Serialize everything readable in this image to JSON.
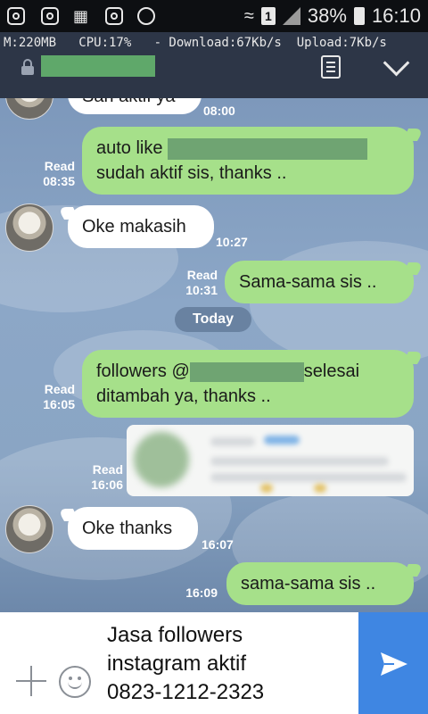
{
  "status_bar": {
    "battery": "38%",
    "time": "16:10",
    "sim_badge": "1"
  },
  "monitor": "M:220MB   CPU:17%   - Download:67Kb/s  Upload:7Kb/s",
  "messages": [
    {
      "dir": "in",
      "text": "Sari aktif ya",
      "time": "08:00"
    },
    {
      "dir": "out",
      "line1": "auto like",
      "line2": "sudah aktif sis, thanks ..",
      "read": "Read",
      "time": "08:35"
    },
    {
      "dir": "in",
      "text": "Oke makasih",
      "time": "10:27"
    },
    {
      "dir": "out",
      "text": "Sama-sama sis ..",
      "read": "Read",
      "time": "10:31"
    },
    {
      "dir": "out",
      "line1a": "followers @",
      "line1b": "selesai",
      "line2": "ditambah ya, thanks ..",
      "read": "Read",
      "time": "16:05"
    },
    {
      "dir": "out",
      "type": "image",
      "read": "Read",
      "time": "16:06"
    },
    {
      "dir": "in",
      "text": "Oke thanks",
      "time": "16:07"
    },
    {
      "dir": "out",
      "text": "sama-sama sis ..",
      "time": "16:09"
    }
  ],
  "date_divider": "Today",
  "input": {
    "text_lines": [
      "Jasa followers",
      "instagram aktif",
      "0823-1212-2323"
    ]
  },
  "colors": {
    "outgoing_bubble": "#a6e08a",
    "incoming_bubble": "#ffffff",
    "send_button": "#3f86e2",
    "header": "#2d3647"
  }
}
